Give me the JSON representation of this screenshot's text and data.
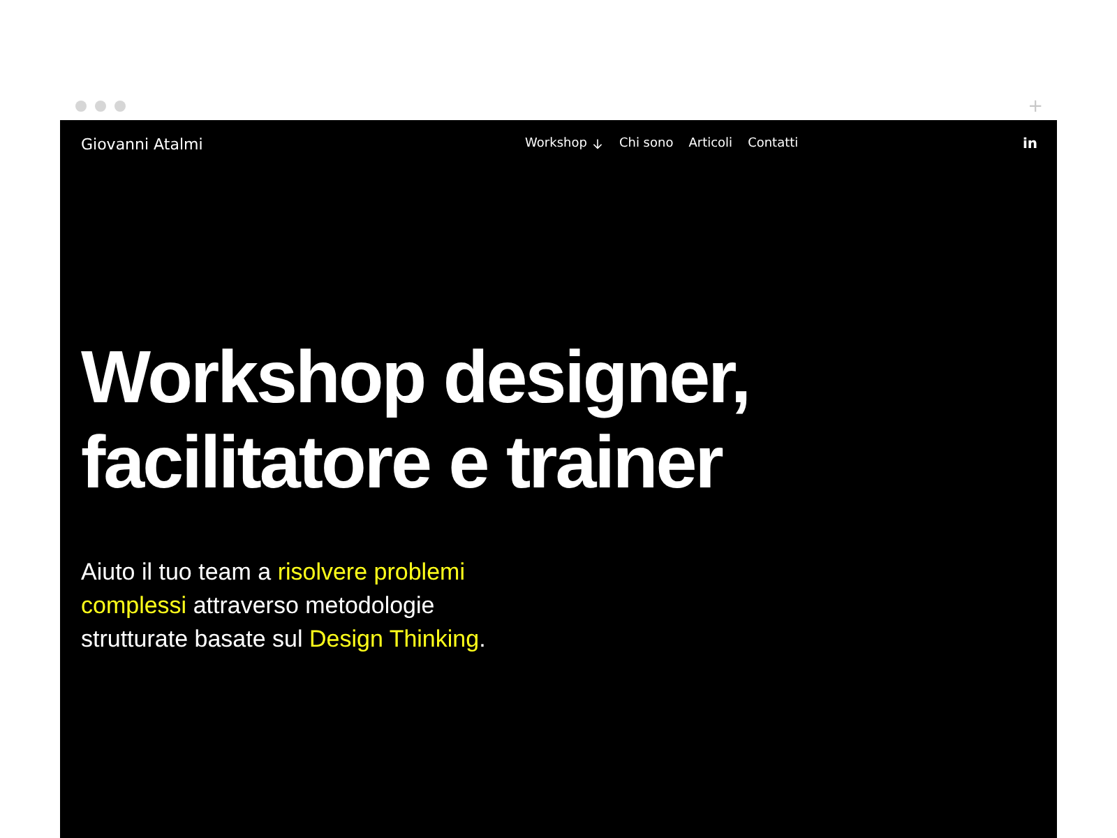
{
  "browser": {
    "new_tab": "+"
  },
  "nav": {
    "brand": "Giovanni Atalmi",
    "links": [
      {
        "label": "Workshop",
        "dropdown": true
      },
      {
        "label": "Chi sono",
        "dropdown": false
      },
      {
        "label": "Articoli",
        "dropdown": false
      },
      {
        "label": "Contatti",
        "dropdown": false
      }
    ],
    "social": "in"
  },
  "hero": {
    "title_lines": [
      "Workshop designer,",
      "facilitatore e trainer"
    ],
    "lead": [
      {
        "text": "Aiuto il tuo team a ",
        "highlight": false
      },
      {
        "text": "risolvere problemi complessi",
        "highlight": true
      },
      {
        "text": " attraverso metodologie strutturate basate sul ",
        "highlight": false
      },
      {
        "text": "Design Thinking",
        "highlight": true
      },
      {
        "text": ".",
        "highlight": false
      }
    ]
  }
}
